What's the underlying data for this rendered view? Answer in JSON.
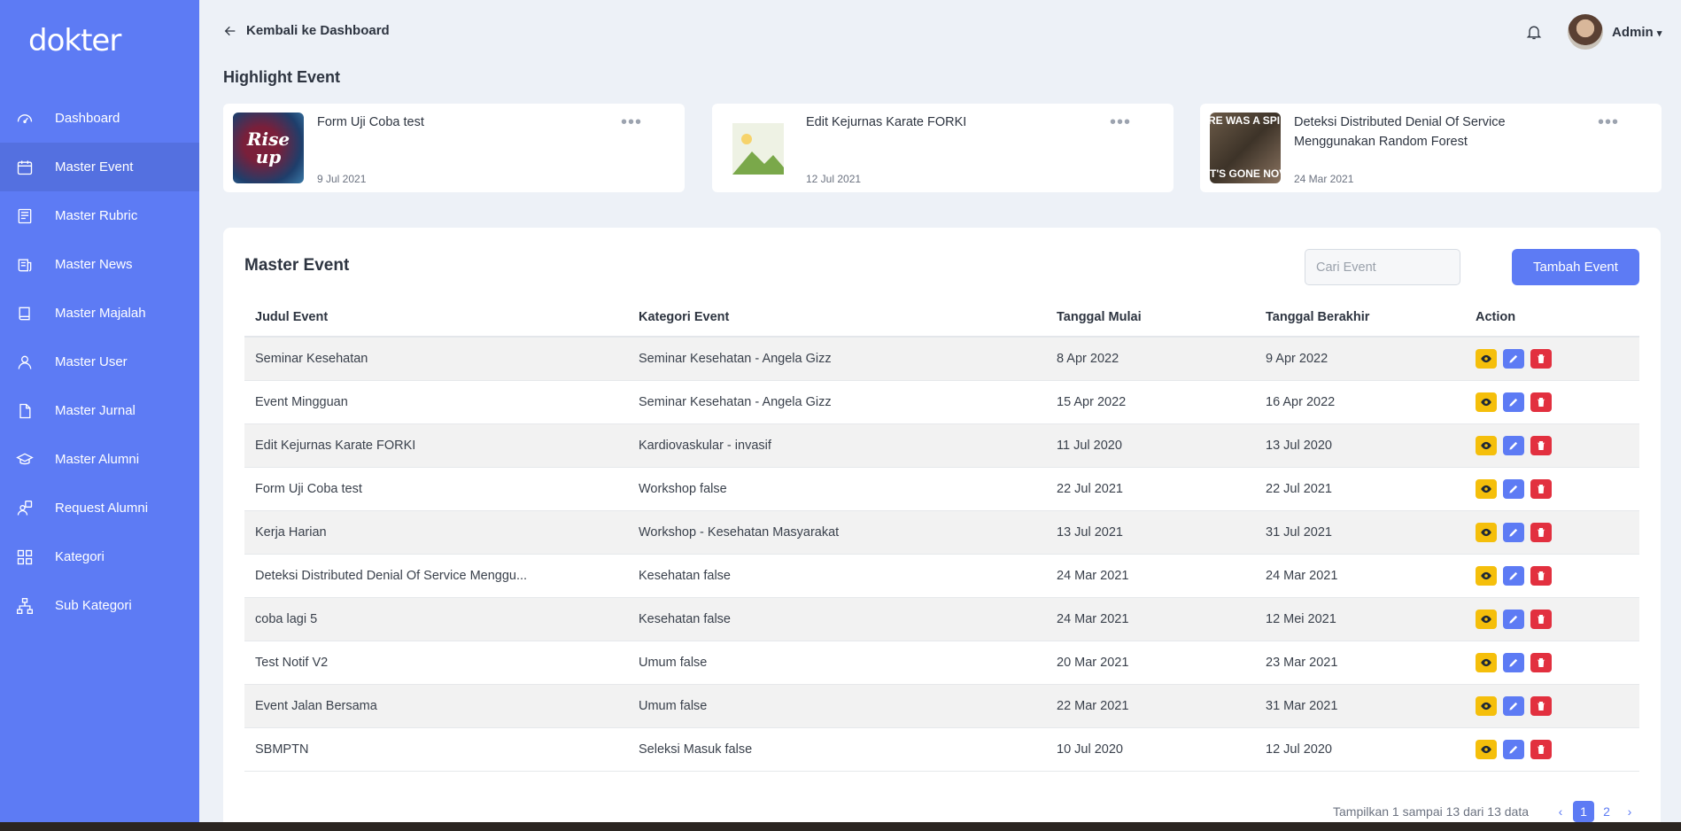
{
  "brand": {
    "logo": "dokter"
  },
  "sidebar": {
    "items": [
      {
        "label": "Dashboard",
        "icon": "dashboard-gauge-icon"
      },
      {
        "label": "Master Event",
        "icon": "calendar-icon",
        "active": true
      },
      {
        "label": "Master Rubric",
        "icon": "newspaper-icon"
      },
      {
        "label": "Master News",
        "icon": "news-icon"
      },
      {
        "label": "Master Majalah",
        "icon": "book-icon"
      },
      {
        "label": "Master User",
        "icon": "user-icon"
      },
      {
        "label": "Master Jurnal",
        "icon": "document-icon"
      },
      {
        "label": "Master Alumni",
        "icon": "graduation-cap-icon"
      },
      {
        "label": "Request Alumni",
        "icon": "user-question-icon"
      },
      {
        "label": "Kategori",
        "icon": "grid-icon"
      },
      {
        "label": "Sub Kategori",
        "icon": "sitemap-icon"
      }
    ]
  },
  "topbar": {
    "back_label": "Kembali ke Dashboard",
    "user_name": "Admin"
  },
  "highlight": {
    "title": "Highlight Event",
    "cards": [
      {
        "name": "Form Uji Coba test",
        "date": "9 Jul 2021",
        "thumb_text": "Rise up"
      },
      {
        "name": "Edit Kejurnas Karate FORKI",
        "date": "12 Jul 2021",
        "thumb_text": ""
      },
      {
        "name": "Deteksi Distributed Denial Of Service Menggunakan Random Forest",
        "date": "24 Mar 2021",
        "thumb_text_top": "RE WAS A SPI",
        "thumb_text_bottom": "T'S GONE NOV"
      }
    ]
  },
  "master": {
    "title": "Master Event",
    "search_placeholder": "Cari Event",
    "add_button": "Tambah Event",
    "columns": [
      "Judul Event",
      "Kategori Event",
      "Tanggal Mulai",
      "Tanggal Berakhir",
      "Action"
    ],
    "rows": [
      [
        "Seminar Kesehatan",
        "Seminar Kesehatan - Angela Gizz",
        "8 Apr 2022",
        "9 Apr 2022"
      ],
      [
        "Event Mingguan",
        "Seminar Kesehatan - Angela Gizz",
        "15 Apr 2022",
        "16 Apr 2022"
      ],
      [
        "Edit Kejurnas Karate FORKI",
        "Kardiovaskular - invasif",
        "11 Jul 2020",
        "13 Jul 2020"
      ],
      [
        "Form Uji Coba test",
        "Workshop false",
        "22 Jul 2021",
        "22 Jul 2021"
      ],
      [
        "Kerja Harian",
        "Workshop - Kesehatan Masyarakat",
        "13 Jul 2021",
        "31 Jul 2021"
      ],
      [
        "Deteksi Distributed Denial Of Service Menggu...",
        "Kesehatan false",
        "24 Mar 2021",
        "24 Mar 2021"
      ],
      [
        "coba lagi 5",
        "Kesehatan false",
        "24 Mar 2021",
        "12 Mei 2021"
      ],
      [
        "Test Notif V2",
        "Umum false",
        "20 Mar 2021",
        "23 Mar 2021"
      ],
      [
        "Event Jalan Bersama",
        "Umum false",
        "22 Mar 2021",
        "31 Mar 2021"
      ],
      [
        "SBMPTN",
        "Seleksi Masuk false",
        "10 Jul 2020",
        "12 Jul 2020"
      ]
    ],
    "pagination": {
      "info": "Tampilkan 1 sampai 13 dari 13 data",
      "pages": [
        "1",
        "2"
      ],
      "current": "1"
    }
  },
  "colors": {
    "primary": "#5d7bf4",
    "view": "#f5bf0b",
    "delete": "#e2303f",
    "background": "#edf1f7"
  }
}
